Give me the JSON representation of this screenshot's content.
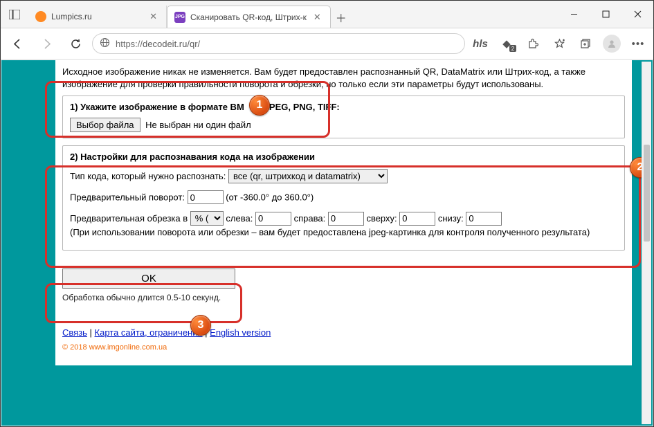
{
  "tabs": [
    {
      "title": "Lumpics.ru",
      "fav_bg": "#ff8a23",
      "fav_text": ""
    },
    {
      "title": "Сканировать QR-код, Штрих-к",
      "fav_bg": "#7b3fbf",
      "fav_text": "JPG"
    }
  ],
  "addr": {
    "proto": "https://",
    "rest": "decodeit.ru/qr/"
  },
  "toolbar_badge": "2",
  "hls_label": "hls",
  "intro": "Исходное изображение никак не изменяется. Вам будет предоставлен распознанный QR, DataMatrix или Штрих-код, а также изображение для проверки правильности поворота и обрезки, но только если эти параметры будут использованы.",
  "section1": {
    "head_pre": "1) Укажите изображение в формате BM",
    "head_post": "JPEG, PNG, TIFF:",
    "file_button": "Выбор файла",
    "file_status": "Не выбран ни один файл"
  },
  "section2": {
    "head": "2) Настройки для распознавания кода на изображении",
    "type_label": "Тип кода, который нужно распознать:",
    "type_value": "все (qr, штрихкод и datamatrix)",
    "rotate_label": "Предварительный поворот:",
    "rotate_value": "0",
    "rotate_range": "(от -360.0° до 360.0°)",
    "crop_label": "Предварительная обрезка в",
    "crop_unit": "% (",
    "crop_left_label": "слева:",
    "crop_left": "0",
    "crop_right_label": "справа:",
    "crop_right": "0",
    "crop_top_label": "сверху:",
    "crop_top": "0",
    "crop_bottom_label": "снизу:",
    "crop_bottom": "0",
    "note": "(При использовании поворота или обрезки – вам будет предоставлена jpeg-картинка для контроля полученного результата)"
  },
  "ok_label": "OK",
  "processing": "Обработка обычно длится 0.5-10 секунд.",
  "footer": {
    "link1": "Связь",
    "sep": " | ",
    "link2": "Карта сайта, ограничения",
    "link3": "English version"
  },
  "copyright": "© 2018 www.imgonline.com.ua",
  "badges": {
    "b1": "1",
    "b2": "2",
    "b3": "3"
  }
}
